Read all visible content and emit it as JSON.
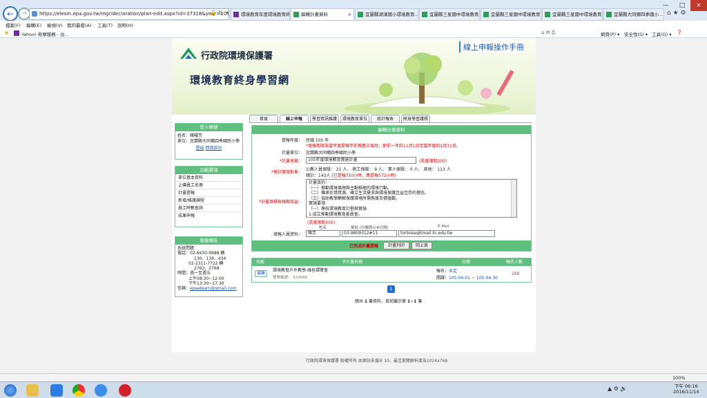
{
  "browser": {
    "address": "https://elesm.epa.gov.tw/mgr/declaration/plan-edit.aspx?id=37318&year=105",
    "tabs": [
      {
        "label": "環境教育年度環境教育終身學習...",
        "active": false
      },
      {
        "label": "編輯計畫資料",
        "active": true
      },
      {
        "label": "宜蘭縣湖濱國小環境教育...",
        "active": false
      },
      {
        "label": "宜蘭縣三星國中環境教育...",
        "active": false
      },
      {
        "label": "宜蘭縣三星國中環境教育...",
        "active": false
      },
      {
        "label": "宜蘭縣三星國中環境教育...",
        "active": false
      },
      {
        "label": "宜蘭縣大同鄉四季國小...",
        "active": false
      }
    ],
    "menu": [
      "檔案(F)",
      "編輯(E)",
      "檢視(V)",
      "我的最愛(A)",
      "工具(T)",
      "說明(H)"
    ],
    "fav": "Yahoo! 奇摩服務 - 台...",
    "cmd": [
      "網頁(P) ▾",
      "安全性(S) ▾",
      "工具(O) ▾"
    ],
    "zoom": "100%"
  },
  "site": {
    "logo": "行政院環境保護署",
    "title": "環境教育終身學習網",
    "manual": "線上申報操作手冊",
    "nav": [
      "首頁",
      "線上申報",
      "學習資訊維護",
      "環境教育單位",
      "統計報表",
      "終身學習護照"
    ]
  },
  "login": {
    "head": "登入帳號",
    "name_line": "姓名：陳曜芳",
    "unit_line": "單位：宜蘭縣大同鄉四季國民小學",
    "logout": "登出",
    "back": "回到前台"
  },
  "func": {
    "head": "功能選項",
    "items": [
      "單位基本資料",
      "上傳員工名冊",
      "計畫提報",
      "新增/維護課程",
      "員工時數查詢",
      "成果申報"
    ]
  },
  "service": {
    "head": "客服專區",
    "lines": [
      "系統問題",
      "電話：02-6630-9988 轉",
      "130、136、434",
      "02-2311-7722 轉",
      "2762、2768",
      "時間：週一至週五",
      "上午08:30~12:00",
      "下午13:30~17:30"
    ],
    "mail_label": "信箱：",
    "mail": "epaelearn@gmail.com"
  },
  "form": {
    "head": "編輯計畫資料",
    "year_label": "提報年度：",
    "year": "民國 105 年",
    "year_note": "*填報期限為當年度提報年前推算三個月，即前一年的11月1日至當年度的1月31日。",
    "unit_label": "計畫單位：",
    "unit": "宜蘭縣大同鄉四季國民小學",
    "name_label": "*計畫名稱：",
    "name": "105年度環境教育實施計畫",
    "name_limit": "(長度限制200)",
    "people_label": "*預計實施對象：",
    "people": "公教人員保險： 21 人、 勞工保險： 9 人、 軍人保險： 0 人、 其他： 113 人",
    "people_total": "總計：143人",
    "people_note": "(已提報750小時，應提報572小時)",
    "goal_label": "*計畫目標與預期效益：",
    "goal_lines": [
      "計畫目的：",
      "（一）推動環境倫理與主動積極的環境行動。",
      "（二）傳承珍惜資源、確立生活需求與環境保護互益互存的理念。",
      "（三）協助教學瞭解保護環境所需態度及價值觀。",
      "實施要項",
      "（一）學校環境教育計劃與實施",
      "1.成立推動環境教育委員會。"
    ],
    "goal_limit": "(長度限制500)",
    "contact_label": "填報人員資料：",
    "col_name": "姓名",
    "col_phone": "電話 (分機請以#分隔)",
    "col_mail": "E-Mail",
    "contact_name": "陳芳",
    "contact_phone": "03-9809312#11",
    "contact_mail": "tortoise@tmail.ilc.edu.tw",
    "done": "已完成計畫提報",
    "print": "計畫列印",
    "back": "回上頁"
  },
  "list": {
    "headers": [
      "功能",
      "子計畫名稱",
      "日期",
      "報名人數"
    ],
    "row": {
      "edit": "編輯",
      "title": "環境教育戶外教學-綠色環覽會",
      "code": "營隊編號： 024666",
      "signup_label": "報名：",
      "signup": "未定",
      "open_label": "開課：",
      "open": "105-04-01 ~ 105-04-30",
      "count": "150"
    },
    "page": "1",
    "summary_pre": "總共",
    "summary_total": "1",
    "summary_mid": "筆資料，目前顯示第",
    "summary_range": "1~1",
    "summary_end": "筆"
  },
  "footer": "行政院環境保護署 版權所有 本網站支援IE 10，最佳瀏覽解析度為1024x768",
  "taskbar": {
    "time": "下午 06:16",
    "date": "2016/11/14"
  }
}
